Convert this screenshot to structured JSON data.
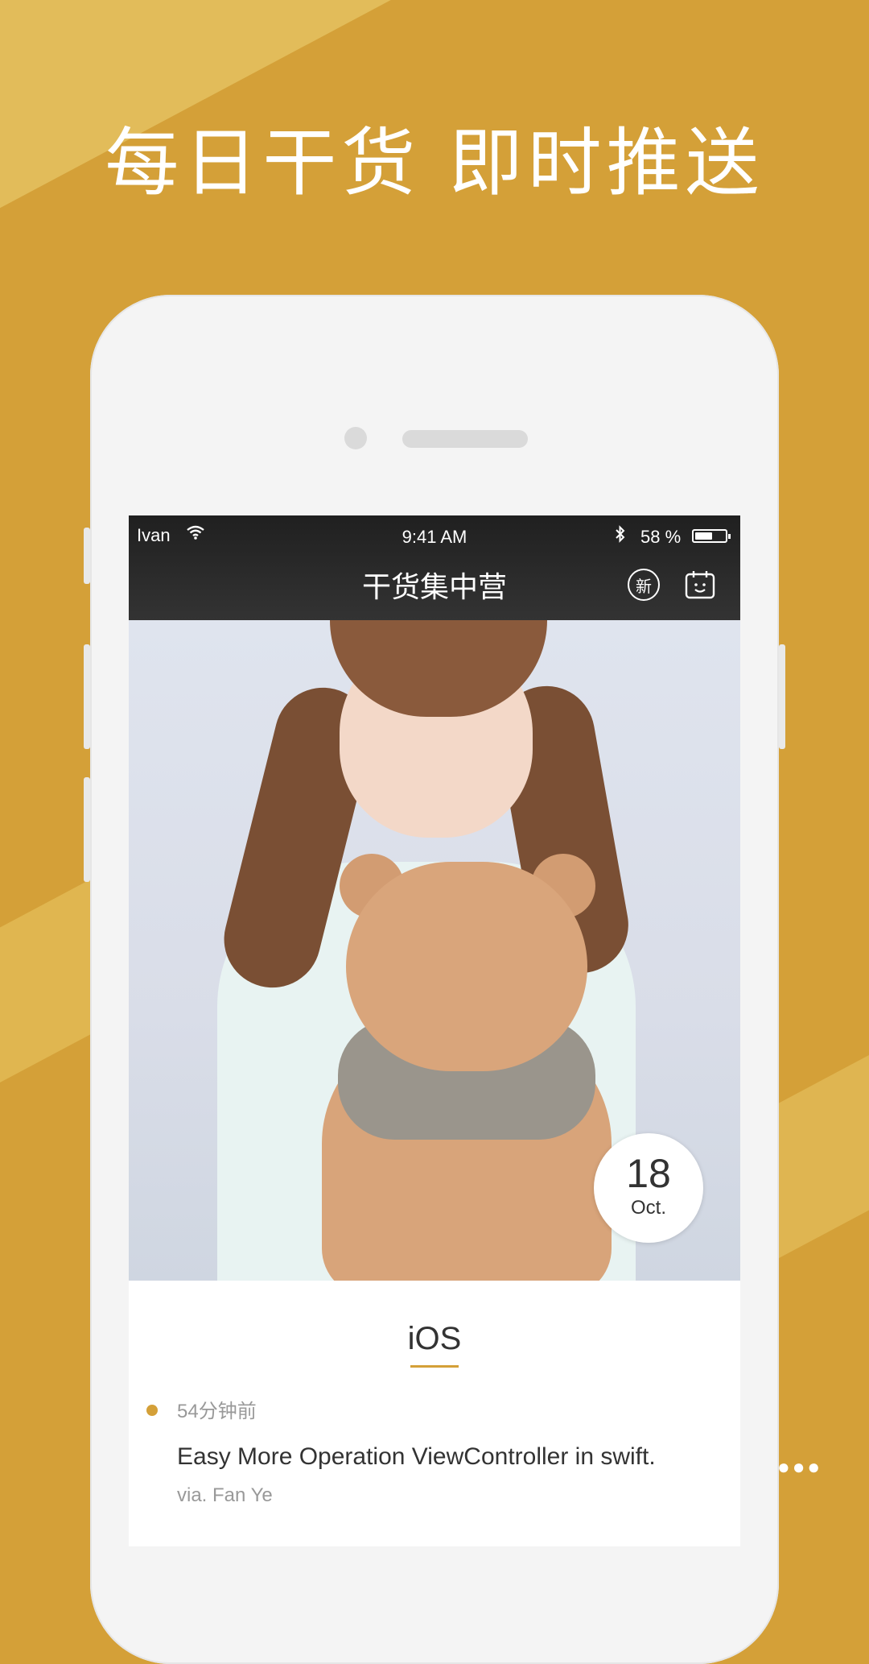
{
  "colors": {
    "brand": "#D4A038",
    "appbar": "#2a2a2a"
  },
  "headline": "每日干货 即时推送",
  "status_bar": {
    "carrier": "Ivan",
    "time": "9:41 AM",
    "battery_percent_text": "58 %",
    "battery_level": 0.58
  },
  "app": {
    "title": "干货集中营",
    "new_icon_label": "新"
  },
  "date": {
    "day": "18",
    "month": "Oct."
  },
  "category": "iOS",
  "post": {
    "time": "54分钟前",
    "title": "Easy More Operation ViewController in swift.",
    "via": "via. Fan Ye"
  },
  "icons": [
    "wifi-icon",
    "bluetooth-icon",
    "battery-icon",
    "new-icon",
    "calendar-icon",
    "more-icon"
  ]
}
